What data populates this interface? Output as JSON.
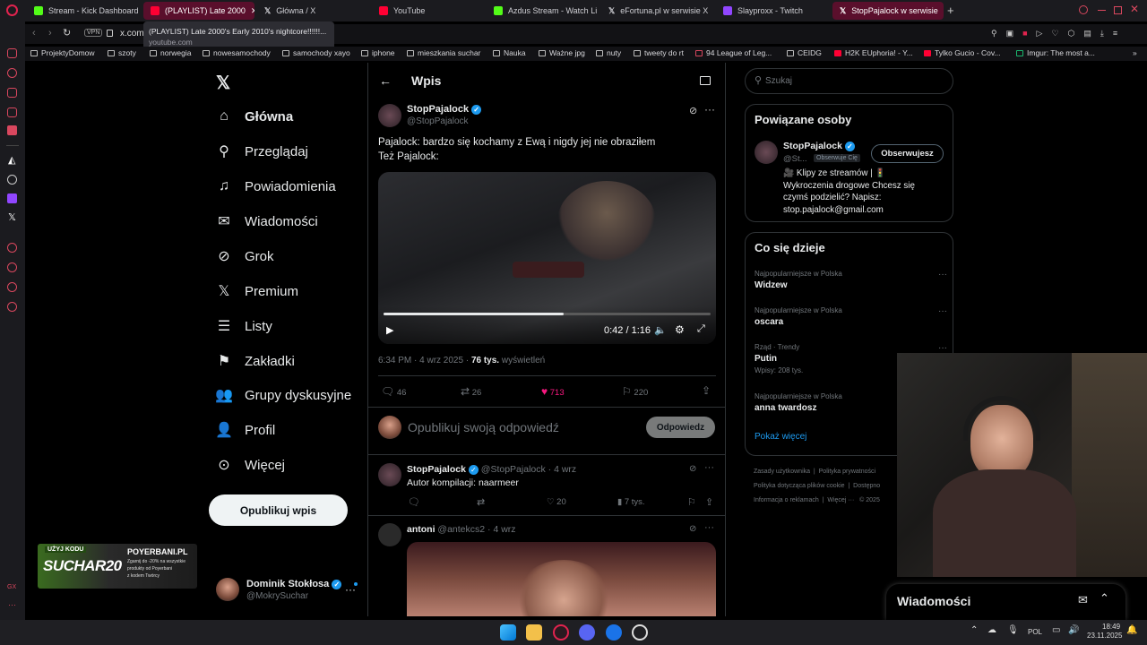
{
  "tabs": [
    {
      "label": "Stream - Kick Dashboard",
      "color": "#53fc18"
    },
    {
      "label": "(PLAYLIST) Late 2000",
      "color": "#ff0033"
    },
    {
      "label": "Główna / X",
      "color": "#ffffff"
    },
    {
      "label": "YouTube",
      "color": "#ff0033"
    },
    {
      "label": "Azdus Stream - Watch Li",
      "color": "#53fc18"
    },
    {
      "label": "eFortuna.pl w serwisie X",
      "color": "#ffffff"
    },
    {
      "label": "Slayproxx - Twitch",
      "color": "#9146ff"
    },
    {
      "label": "StopPajalock w serwisie",
      "color": "#ffffff"
    }
  ],
  "tooltip": {
    "title": "(PLAYLIST) Late 2000's Early 2010's nightcore!!!!!!...",
    "sub": "youtube.com"
  },
  "address": {
    "vpn": "VPN",
    "url": "x.com"
  },
  "bookmarks": [
    "ProjektyDomow",
    "szoty",
    "norwegia",
    "nowesamochody",
    "samochody xayo",
    "iphone",
    "mieszkania suchar",
    "Nauka",
    "Ważne jpg",
    "nuty",
    "tweety do rt",
    "94 League of Leg...",
    "CEIDG",
    "H2K EUphoria! - Y...",
    "Tylko Gucio - Cov...",
    "Imgur: The most a..."
  ],
  "nav": {
    "items": [
      "Główna",
      "Przeglądaj",
      "Powiadomienia",
      "Wiadomości",
      "Grok",
      "Premium",
      "Listy",
      "Zakładki",
      "Grupy dyskusyjne",
      "Profil",
      "Więcej"
    ],
    "post_button": "Opublikuj wpis",
    "account": {
      "name": "Dominik Stokłosa",
      "handle": "@MokrySuchar"
    }
  },
  "promo": {
    "brand": "POYERBANI.PL",
    "code_top": "UŻYJ KODU",
    "code": "SUCHAR20",
    "line1": "Zgarnij do -20% na wszystkie",
    "line2": "produkty od Poyerbani",
    "line3": "z kodem Twórcy"
  },
  "post": {
    "header": "Wpis",
    "author": "StopPajalock",
    "handle": "@StopPajalock",
    "text1": "Pajalock: bardzo się kochamy z Ewą i nigdy jej nie obraziłem",
    "text2": "Też Pajalock:",
    "video_time": "0:42 / 1:16",
    "video_progress": 0.55,
    "meta_time": "6:34 PM · 4 wrz 2025 ·",
    "views_count": "76 tys.",
    "views_label": "wyświetleń",
    "replies": "46",
    "reposts": "26",
    "likes": "713",
    "bookmarks": "220",
    "reply_placeholder": "Opublikuj swoją odpowiedź",
    "reply_button": "Odpowiedz"
  },
  "replies": [
    {
      "author": "StopPajalock",
      "handle": "@StopPajalock · 4 wrz",
      "text": "Autor kompilacji: naarmeer",
      "likes": "20",
      "views": "7 tys."
    },
    {
      "author": "antoni",
      "handle": "@antekcs2 · 4 wrz"
    }
  ],
  "search": {
    "placeholder": "Szukaj"
  },
  "related": {
    "title": "Powiązane osoby",
    "name": "StopPajalock",
    "handle": "@St...",
    "follows_you": "Obserwuje Cię",
    "follow_button": "Obserwujesz",
    "bio": "🎥 Klipy ze streamów | 🚦 Wykroczenia drogowe Chcesz się czymś podzielić? Napisz: stop.pajalock@gmail.com"
  },
  "trends": {
    "title": "Co się dzieje",
    "items": [
      {
        "meta": "Najpopularniejsze w Polska",
        "name": "Widzew"
      },
      {
        "meta": "Najpopularniejsze w Polska",
        "name": "oscara"
      },
      {
        "meta": "Rząd · Trendy",
        "name": "Putin",
        "sub": "Wpisy: 208 tys."
      },
      {
        "meta": "Najpopularniejsze w Polska",
        "name": "anna twardosz"
      }
    ],
    "more": "Pokaż więcej"
  },
  "footer": [
    "Zasady użytkownika",
    "Polityka prywatności",
    "Polityka dotycząca plików cookie",
    "Dostępno",
    "Informacja o reklamach",
    "Więcej ···",
    "© 2025"
  ],
  "messages_dock": "Wiadomości",
  "taskbar": {
    "lang": "POL",
    "time": "18:49",
    "date": "23.11.2025"
  }
}
